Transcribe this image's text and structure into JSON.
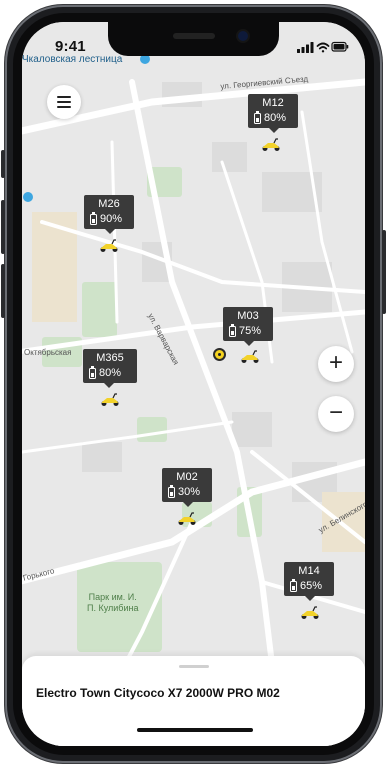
{
  "status_bar": {
    "time": "9:41"
  },
  "map": {
    "streets": {
      "top_left": "Чкаловская лестница",
      "top_right": "ул. Георгиевский Съезд",
      "diagonal": "ул. Варварская",
      "left_mid": "Октябрьская",
      "right_low": "ул. Белинского",
      "left_low": "Горького",
      "park": "Парк им. И.\nП. Кулибина"
    },
    "markers": [
      {
        "name": "M12",
        "battery": "80%"
      },
      {
        "name": "M26",
        "battery": "90%"
      },
      {
        "name": "M03",
        "battery": "75%"
      },
      {
        "name": "M365",
        "battery": "80%"
      },
      {
        "name": "M02",
        "battery": "30%"
      },
      {
        "name": "M14",
        "battery": "65%"
      }
    ],
    "zoom_in": "+",
    "zoom_out": "−"
  },
  "sheet": {
    "title": "Electro Town Citycoco X7 2000W PRO M02"
  },
  "colors": {
    "scooter": "#f2d22a",
    "label_bg": "#3a3a3a",
    "park": "#cfe3c9"
  },
  "icons": [
    "menu-icon",
    "battery-icon",
    "scooter-icon",
    "signal-icon",
    "wifi-icon",
    "battery-status-icon",
    "map-pin-icon"
  ]
}
